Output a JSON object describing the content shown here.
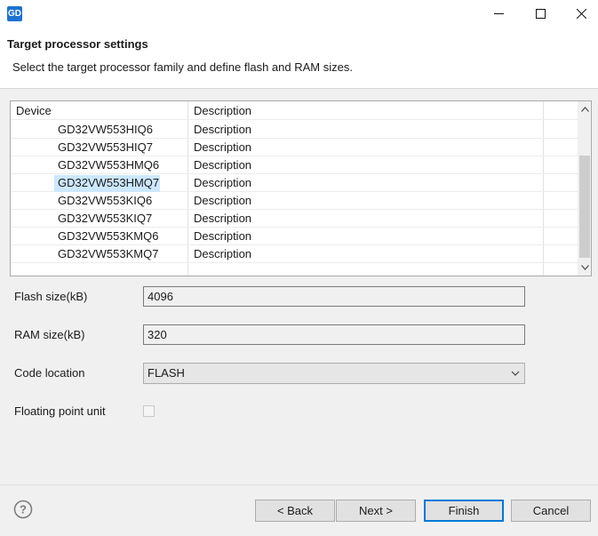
{
  "window": {
    "logo_text": "GD",
    "minimize_icon": "minimize-icon",
    "maximize_icon": "maximize-icon",
    "close_icon": "close-icon"
  },
  "header": {
    "title": "Target processor settings",
    "subtitle": "Select the target processor family and define flash and RAM sizes."
  },
  "table": {
    "columns": [
      "Device",
      "Description"
    ],
    "rows": [
      {
        "device": "GD32VW553HIQ6",
        "description": "Description"
      },
      {
        "device": "GD32VW553HIQ7",
        "description": "Description"
      },
      {
        "device": "GD32VW553HMQ6",
        "description": "Description"
      },
      {
        "device": "GD32VW553HMQ7",
        "description": "Description",
        "selected": true
      },
      {
        "device": "GD32VW553KIQ6",
        "description": "Description"
      },
      {
        "device": "GD32VW553KIQ7",
        "description": "Description"
      },
      {
        "device": "GD32VW553KMQ6",
        "description": "Description"
      },
      {
        "device": "GD32VW553KMQ7",
        "description": "Description"
      }
    ],
    "selected_color": "#cce8ff"
  },
  "form": {
    "flash_label": "Flash size(kB)",
    "flash_value": "4096",
    "ram_label": "RAM size(kB)",
    "ram_value": "320",
    "code_location_label": "Code location",
    "code_location_value": "FLASH",
    "fpu_label": "Floating point unit",
    "fpu_checked": false
  },
  "footer": {
    "help_icon": "help-icon",
    "back_label": "< Back",
    "next_label": "Next >",
    "finish_label": "Finish",
    "cancel_label": "Cancel"
  },
  "colors": {
    "accent": "#0078d7",
    "logo": "#1e73d2"
  }
}
